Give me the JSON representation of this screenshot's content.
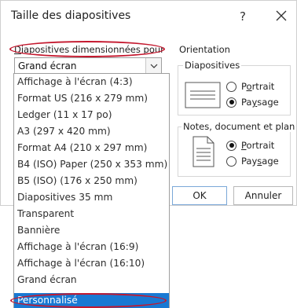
{
  "dialog": {
    "title": "Taille des diapositives",
    "help_label": "?"
  },
  "slide_size": {
    "label": "Diapositives dimensionnées pour",
    "label_accel_char": "D",
    "label_rest": "iapositives dimensionnées pour",
    "selected_value": "Grand écran",
    "options": [
      "Affichage à l'écran (4:3)",
      "Format US (216 x 279 mm)",
      "Ledger (11 x 17 po)",
      "A3 (297 x 420 mm)",
      "Format A4 (210 x 297 mm)",
      "B4 (ISO) Paper (250 x 353 mm)",
      "B5 (ISO) (176 x 250 mm)",
      "Diapositives 35 mm",
      "Transparent",
      "Bannière",
      "Affichage à l'écran (16:9)",
      "Affichage à l'écran (16:10)",
      "Grand écran",
      "Personnalisé"
    ],
    "highlighted_option": "Personnalisé"
  },
  "orientation": {
    "label": "Orientation",
    "slides": {
      "title": "Diapositives",
      "portrait": {
        "pre": "P",
        "accel": "o",
        "post": "rtrait",
        "checked": false
      },
      "landscape": {
        "pre": "Pa",
        "accel": "y",
        "post": "sage",
        "checked": true
      }
    },
    "notes": {
      "title": "Notes, document et plan",
      "portrait": {
        "pre": "",
        "accel": "P",
        "post": "ortrait",
        "checked": true
      },
      "landscape": {
        "pre": "Pay",
        "accel": "s",
        "post": "age",
        "checked": false
      }
    }
  },
  "buttons": {
    "ok_label": "OK",
    "cancel_label": "Annuler"
  },
  "colors": {
    "highlight": "#1979d3",
    "annotation_ring": "#c4182e"
  }
}
